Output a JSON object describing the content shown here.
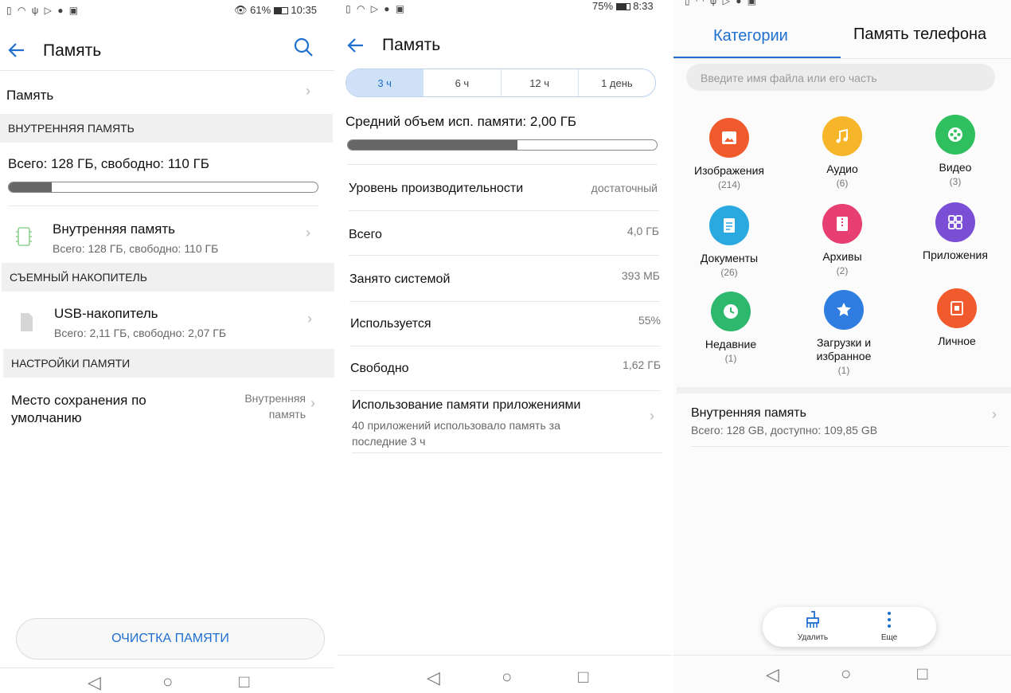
{
  "colors": {
    "accent": "#1f6fd0",
    "bar": "#666666",
    "section_bg": "#f0f0f0"
  },
  "screen1": {
    "status_time": "10:35",
    "status_battery": "61%",
    "title": "Память",
    "memory_row_label": "Память",
    "section_internal": "ВНУТРЕННЯЯ ПАМЯТЬ",
    "total_free": "Всего: 128 ГБ, свободно: 110 ГБ",
    "usage_fraction": 0.14,
    "internal_item_title": "Внутренняя память",
    "internal_item_sub": "Всего: 128 ГБ, свободно: 110 ГБ",
    "section_removable": "СЪЕМНЫЙ НАКОПИТЕЛЬ",
    "usb_title": "USB-накопитель",
    "usb_sub": "Всего: 2,11 ГБ, свободно: 2,07 ГБ",
    "section_settings": "НАСТРОЙКИ ПАМЯТИ",
    "default_location_label": "Место сохранения по умолчанию",
    "default_location_value_1": "Внутренняя",
    "default_location_value_2": "память",
    "clean_button": "ОЧИСТКА ПАМЯТИ"
  },
  "screen2": {
    "status_time": "8:33",
    "status_battery": "75%",
    "title": "Память",
    "periods": [
      "3 ч",
      "6 ч",
      "12 ч",
      "1 день"
    ],
    "active_period_index": 0,
    "avg_usage": "Средний объем исп. памяти: 2,00 ГБ",
    "avg_usage_fraction": 0.55,
    "rows": [
      {
        "label": "Уровень производительности",
        "value": "достаточный"
      },
      {
        "label": "Всего",
        "value": "4,0 ГБ"
      },
      {
        "label": "Занято системой",
        "value": "393 МБ"
      },
      {
        "label": "Используется",
        "value": "55%"
      },
      {
        "label": "Свободно",
        "value": "1,62 ГБ"
      }
    ],
    "app_usage_title": "Использование памяти приложениями",
    "app_usage_sub_1": "40 приложений использовало память за",
    "app_usage_sub_2": "последние 3 ч"
  },
  "screen3": {
    "tab_categories": "Категории",
    "tab_phone": "Память телефона",
    "search_placeholder": "Введите имя файла или его часть",
    "categories": [
      {
        "label": "Изображения",
        "count": "(214)",
        "color": "#f05a2c",
        "icon": "image-icon"
      },
      {
        "label": "Аудио",
        "count": "(6)",
        "color": "#f7b52a",
        "icon": "music-icon"
      },
      {
        "label": "Видео",
        "count": "(3)",
        "color": "#2fbf5e",
        "icon": "video-reel-icon"
      },
      {
        "label": "Документы",
        "count": "(26)",
        "color": "#29a9e0",
        "icon": "document-icon"
      },
      {
        "label": "Архивы",
        "count": "(2)",
        "color": "#e83f72",
        "icon": "archive-icon"
      },
      {
        "label": "Приложения",
        "count": "",
        "color": "#7a4fd6",
        "icon": "apps-grid-icon"
      },
      {
        "label": "Недавние",
        "count": "(1)",
        "color": "#2db86e",
        "icon": "clock-icon"
      },
      {
        "label": "Загрузки и избранное",
        "count": "(1)",
        "color": "#2f7de0",
        "icon": "star-icon"
      },
      {
        "label": "Личное",
        "count": "",
        "color": "#f05a2c",
        "icon": "safe-icon"
      }
    ],
    "storage_title": "Внутренняя память",
    "storage_sub": "Всего: 128 GB, доступно: 109,85 GB",
    "delete_label": "Удалить",
    "more_label": "Еще"
  }
}
